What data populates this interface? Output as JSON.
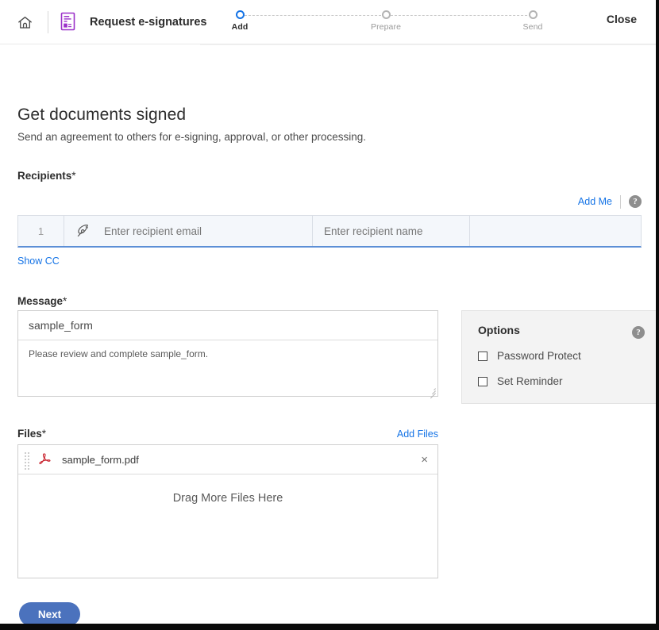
{
  "header": {
    "home_icon": "home-icon",
    "doc_icon": "esign-document-icon",
    "app_title": "Request e-signatures",
    "close_label": "Close",
    "steps": [
      {
        "label": "Add",
        "active": true
      },
      {
        "label": "Prepare",
        "active": false
      },
      {
        "label": "Send",
        "active": false
      }
    ],
    "accent_active": "#1473e6",
    "inactive_dot": "#b4b4b4"
  },
  "page": {
    "title": "Get documents signed",
    "subtitle": "Send an agreement to others for e-signing, approval, or other processing."
  },
  "recipients": {
    "label": "Recipients",
    "required_mark": "*",
    "add_me_label": "Add Me",
    "help_glyph": "?",
    "row": {
      "number": "1",
      "role_icon": "pen-nib-icon",
      "email_placeholder": "Enter recipient email",
      "name_placeholder": "Enter recipient name"
    },
    "show_cc_label": "Show CC"
  },
  "message": {
    "label": "Message",
    "required_mark": "*",
    "subject_value": "sample_form",
    "body_value": "Please review and complete sample_form."
  },
  "options": {
    "title": "Options",
    "help_glyph": "?",
    "items": [
      {
        "label": "Password Protect",
        "checked": false
      },
      {
        "label": "Set Reminder",
        "checked": false
      }
    ]
  },
  "files": {
    "label": "Files",
    "required_mark": "*",
    "add_files_label": "Add Files",
    "items": [
      {
        "name": "sample_form.pdf",
        "icon": "pdf-icon",
        "remove_glyph": "×"
      }
    ],
    "drop_hint": "Drag More Files Here"
  },
  "footer": {
    "next_label": "Next"
  },
  "colors": {
    "link": "#1473e6",
    "primary_button": "#4b72bd",
    "pdf_red": "#c8202b",
    "brand_purple": "#9b30c9"
  }
}
